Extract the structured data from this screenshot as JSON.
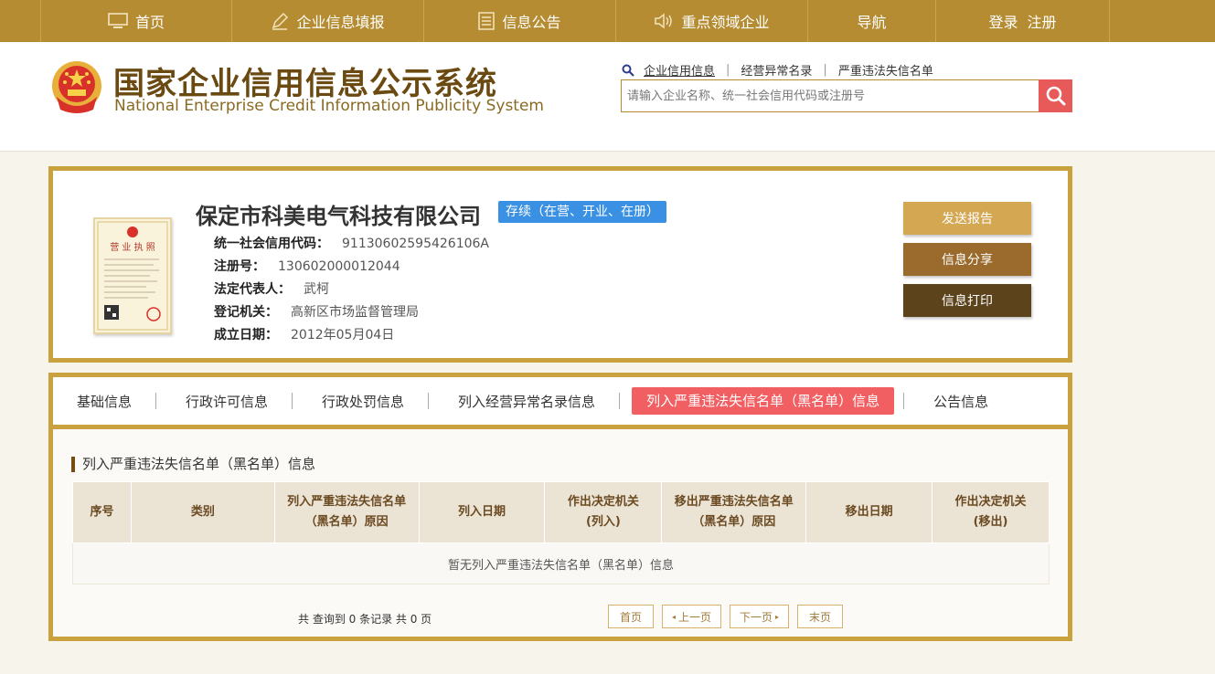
{
  "nav": {
    "home": "首页",
    "report": "企业信息填报",
    "notice": "信息公告",
    "key": "重点领域企业",
    "guide": "导航",
    "login": "登录",
    "register": "注册"
  },
  "header": {
    "title": "国家企业信用信息公示系统",
    "subtitle": "National Enterprise Credit Information Publicity System",
    "quicklinks": [
      "企业信用信息",
      "经营异常名录",
      "严重违法失信名单"
    ],
    "search_placeholder": "请输入企业名称、统一社会信用代码或注册号"
  },
  "company": {
    "name": "保定市科美电气科技有限公司",
    "status": "存续（在营、开业、在册）",
    "license_title": "营 业 执 照",
    "fields": [
      {
        "label": "统一社会信用代码：",
        "value": "91130602595426106A"
      },
      {
        "label": "注册号：",
        "value": "130602000012044"
      },
      {
        "label": "法定代表人：",
        "value": "武柯"
      },
      {
        "label": "登记机关：",
        "value": "高新区市场监督管理局"
      },
      {
        "label": "成立日期：",
        "value": "2012年05月04日"
      }
    ],
    "buttons": {
      "send": "发送报告",
      "share": "信息分享",
      "print": "信息打印"
    }
  },
  "tabs": [
    "基础信息",
    "行政许可信息",
    "行政处罚信息",
    "列入经营异常名录信息",
    "列入严重违法失信名单（黑名单）信息",
    "公告信息"
  ],
  "section": {
    "title": "列入严重违法失信名单（黑名单）信息",
    "columns": [
      "序号",
      "类别",
      "列入严重违法失信名单（黑名单）原因",
      "列入日期",
      "作出决定机关(列入)",
      "移出严重违法失信名单（黑名单）原因",
      "移出日期",
      "作出决定机关(移出)"
    ],
    "empty": "暂无列入严重违法失信名单（黑名单）信息"
  },
  "pager": {
    "summary": "共 查询到 0 条记录 共 0 页",
    "first": "首页",
    "prev": "上一页",
    "next": "下一页",
    "last": "末页"
  },
  "colors": {
    "brand": "#b58c31",
    "accent": "#f25f62",
    "badge": "#3a90e2"
  }
}
